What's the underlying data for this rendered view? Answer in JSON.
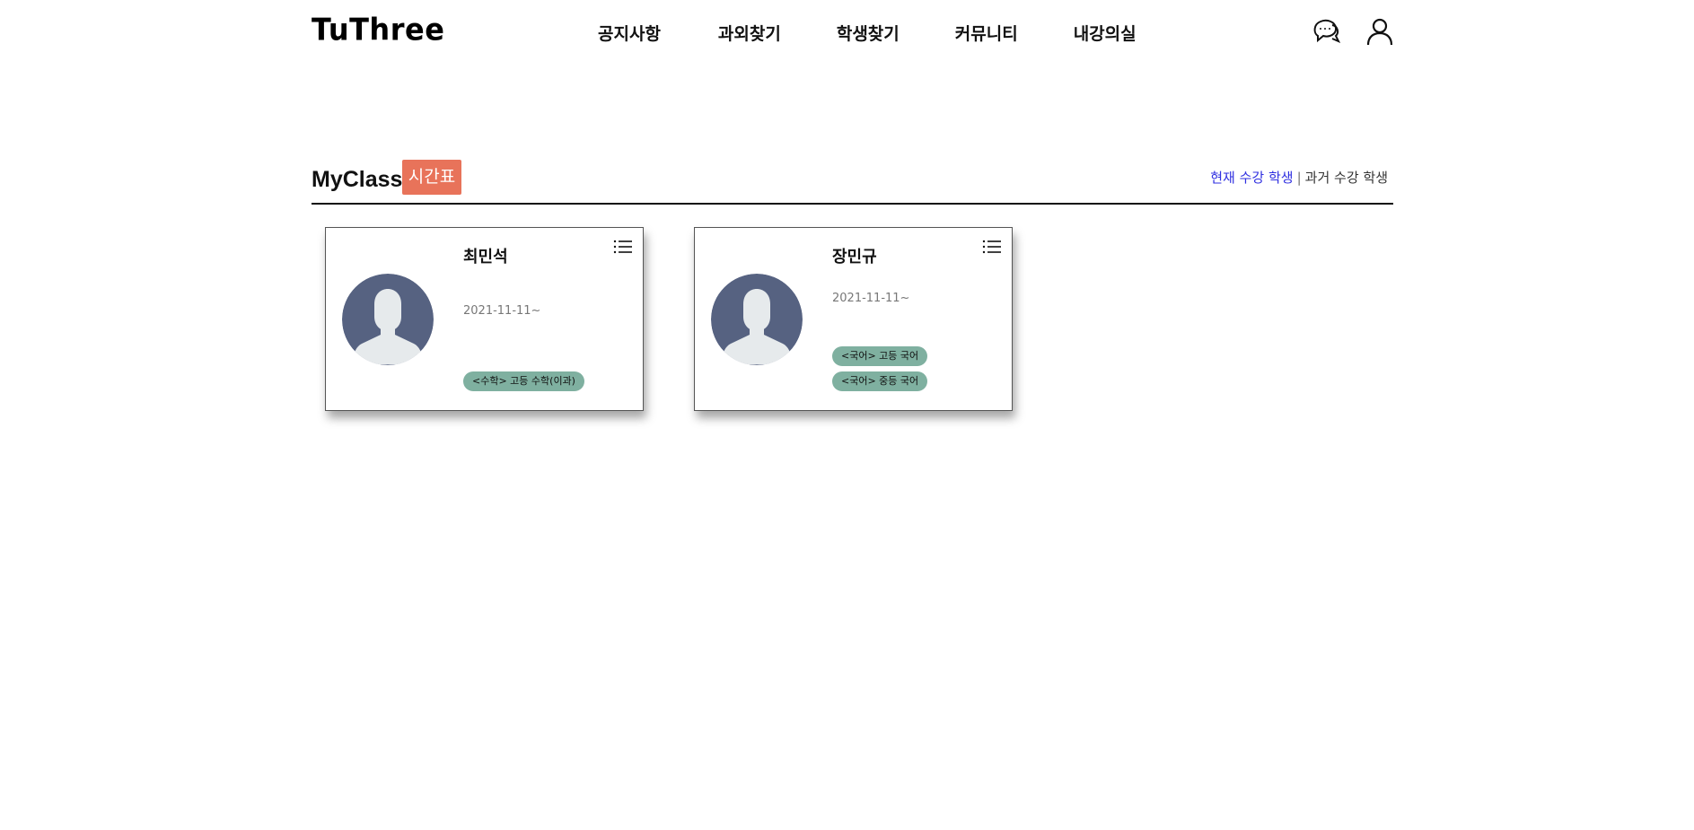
{
  "header": {
    "logo": "TuThree",
    "nav": [
      "공지사항",
      "과외찾기",
      "학생찾기",
      "커뮤니티",
      "내강의실"
    ],
    "icons": [
      "chat-icon",
      "user-icon"
    ]
  },
  "section": {
    "title": "MyClass",
    "schedule_button": "시간표",
    "filter_current": "현재 수강 학생",
    "filter_separator": "|",
    "filter_past": "과거 수강 학생"
  },
  "students": [
    {
      "name": "최민석",
      "date": "2021-11-11~",
      "subjects": [
        "<수학> 고등 수학(이과)"
      ]
    },
    {
      "name": "장민규",
      "date": "2021-11-11~",
      "subjects": [
        "<국어> 고등 국어",
        "<국어> 중등 국어"
      ]
    }
  ],
  "colors": {
    "schedule_button": "#e8735a",
    "filter_current": "#2f2fe0",
    "badge": "#7fb0a0",
    "avatar_bg": "#566281",
    "avatar_fg": "#e6eaec"
  }
}
